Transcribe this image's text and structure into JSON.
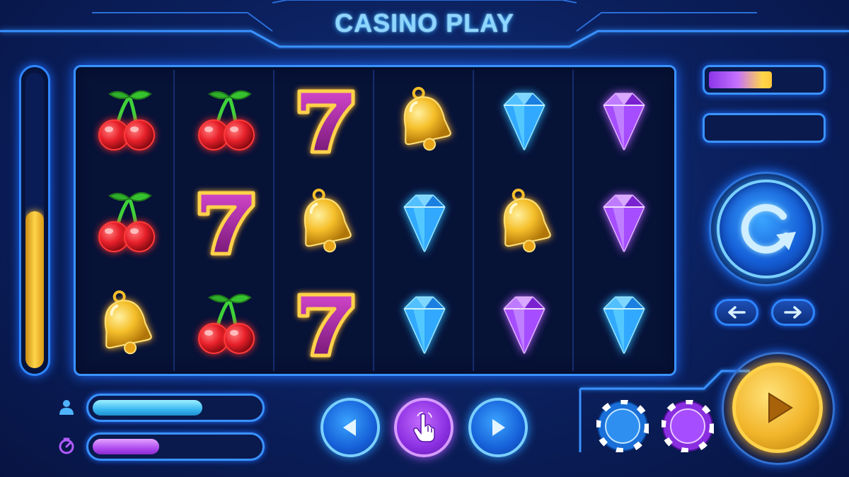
{
  "header": {
    "title": "CASINO PLAY"
  },
  "colors": {
    "neon_blue": "#3a92ff",
    "gold": "#ffd54a",
    "purple": "#a64dff",
    "cherry_red": "#e8202a"
  },
  "power_meter": {
    "level": 0.53
  },
  "reels": [
    [
      "cherry",
      "cherry",
      "bell"
    ],
    [
      "cherry",
      "seven",
      "cherry"
    ],
    [
      "seven",
      "bell",
      "seven"
    ],
    [
      "bell",
      "blue-diamond",
      "blue-diamond"
    ],
    [
      "blue-diamond",
      "bell",
      "purple-diamond"
    ],
    [
      "purple-diamond",
      "purple-diamond",
      "blue-diamond"
    ]
  ],
  "right_panel": {
    "top_bar_fill": 0.6,
    "second_bar": "",
    "spin_icon": "refresh-icon",
    "arrow_left_icon": "arrow-left-icon",
    "arrow_right_icon": "arrow-right-icon",
    "play_icon": "play-icon"
  },
  "stats": {
    "player_bar_fill": 0.68,
    "player_icon": "user-icon",
    "timer_bar_fill": 0.43,
    "timer_icon": "timer-icon"
  },
  "bottom_nav": [
    "prev-icon",
    "tap-hand-icon",
    "next-icon"
  ],
  "chips": [
    "blue-chip",
    "purple-chip"
  ]
}
